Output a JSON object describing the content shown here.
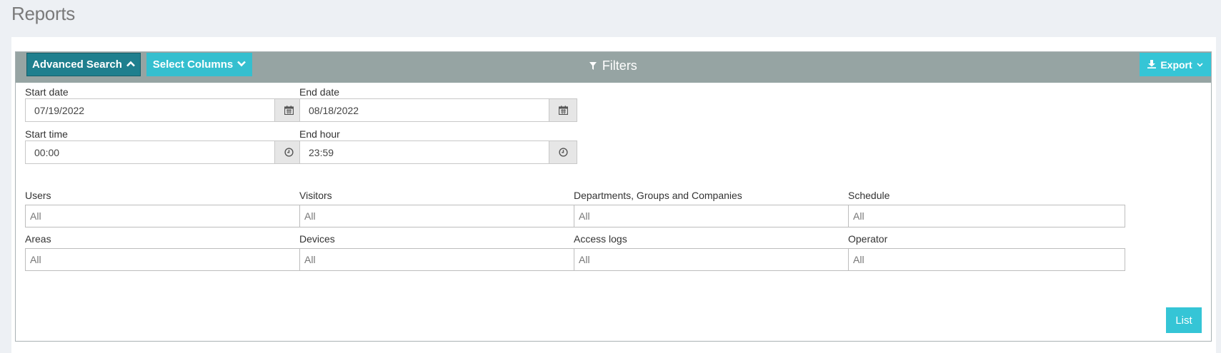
{
  "page": {
    "title": "Reports"
  },
  "header": {
    "advanced_search_label": "Advanced Search",
    "select_columns_label": "Select Columns",
    "filters_title": "Filters",
    "export_label": "Export"
  },
  "dates": {
    "start_date": {
      "label": "Start date",
      "value": "07/19/2022"
    },
    "end_date": {
      "label": "End date",
      "value": "08/18/2022"
    },
    "start_time": {
      "label": "Start time",
      "value": "00:00"
    },
    "end_hour": {
      "label": "End hour",
      "value": "23:59"
    }
  },
  "filters": [
    {
      "label": "Users",
      "value": "All"
    },
    {
      "label": "Visitors",
      "value": "All"
    },
    {
      "label": "Departments, Groups and Companies",
      "value": "All"
    },
    {
      "label": "Schedule",
      "value": "All"
    },
    {
      "label": "Areas",
      "value": "All"
    },
    {
      "label": "Devices",
      "value": "All"
    },
    {
      "label": "Access logs",
      "value": "All"
    },
    {
      "label": "Operator",
      "value": "All"
    }
  ],
  "actions": {
    "list_label": "List"
  },
  "colors": {
    "advanced_search_bg": "#1f7f8e",
    "accent": "#35c5d6",
    "header_bg": "#96a4a3"
  },
  "icons": [
    "chevron-up-icon",
    "chevron-down-icon",
    "filter-icon",
    "download-icon",
    "calendar-icon",
    "clock-icon"
  ]
}
